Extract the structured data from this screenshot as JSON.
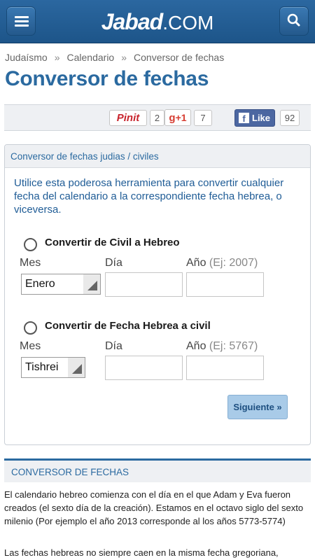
{
  "header": {
    "logo_bold": "Jabad",
    "logo_light": ".COM",
    "menu_icon": "hamburger-menu-icon",
    "search_icon": "search-icon",
    "bar_color": "#1d5589"
  },
  "breadcrumb": {
    "items": [
      "Judaísmo",
      "Calendario",
      "Conversor de fechas"
    ],
    "separator": "»"
  },
  "page_title": "Conversor de fechas",
  "social": {
    "pinterest_label": "Pinit",
    "pinterest_count": "2",
    "gplus_label": "+1",
    "gplus_count": "7",
    "facebook_label": "Like",
    "facebook_count": "92"
  },
  "converter": {
    "panel_title": "Conversor de fechas judias / civiles",
    "intro": "Utilice esta poderosa herramienta para convertir cualquier fecha del calendario a la correspondiente fecha hebrea, o viceversa.",
    "civil_to_hebrew": {
      "label": "Convertir de Civil a Hebreo",
      "mes_label": "Mes",
      "dia_label": "Día",
      "ano_label": "Año",
      "ano_hint": "(Ej: 2007)",
      "month_value": "Enero",
      "day_value": "",
      "year_value": ""
    },
    "hebrew_to_civil": {
      "label": "Convertir de Fecha Hebrea a civil",
      "mes_label": "Mes",
      "dia_label": "Día",
      "ano_label": "Año",
      "ano_hint": "(Ej: 5767)",
      "month_value": "Tishrei",
      "day_value": "",
      "year_value": ""
    },
    "next_button": "Siguiente »"
  },
  "article": {
    "heading": "CONVERSOR DE FECHAS",
    "paragraph1": "El calendario hebreo comienza con el día en el que Adam y Eva fueron creados (el sexto día de la creación). Estamos en el octavo siglo del sexto milenio (Por ejemplo el año 2013 corresponde al los años 5773-5774)",
    "paragraph2": "Las fechas hebreas no siempre caen en la misma fecha gregoriana,"
  }
}
